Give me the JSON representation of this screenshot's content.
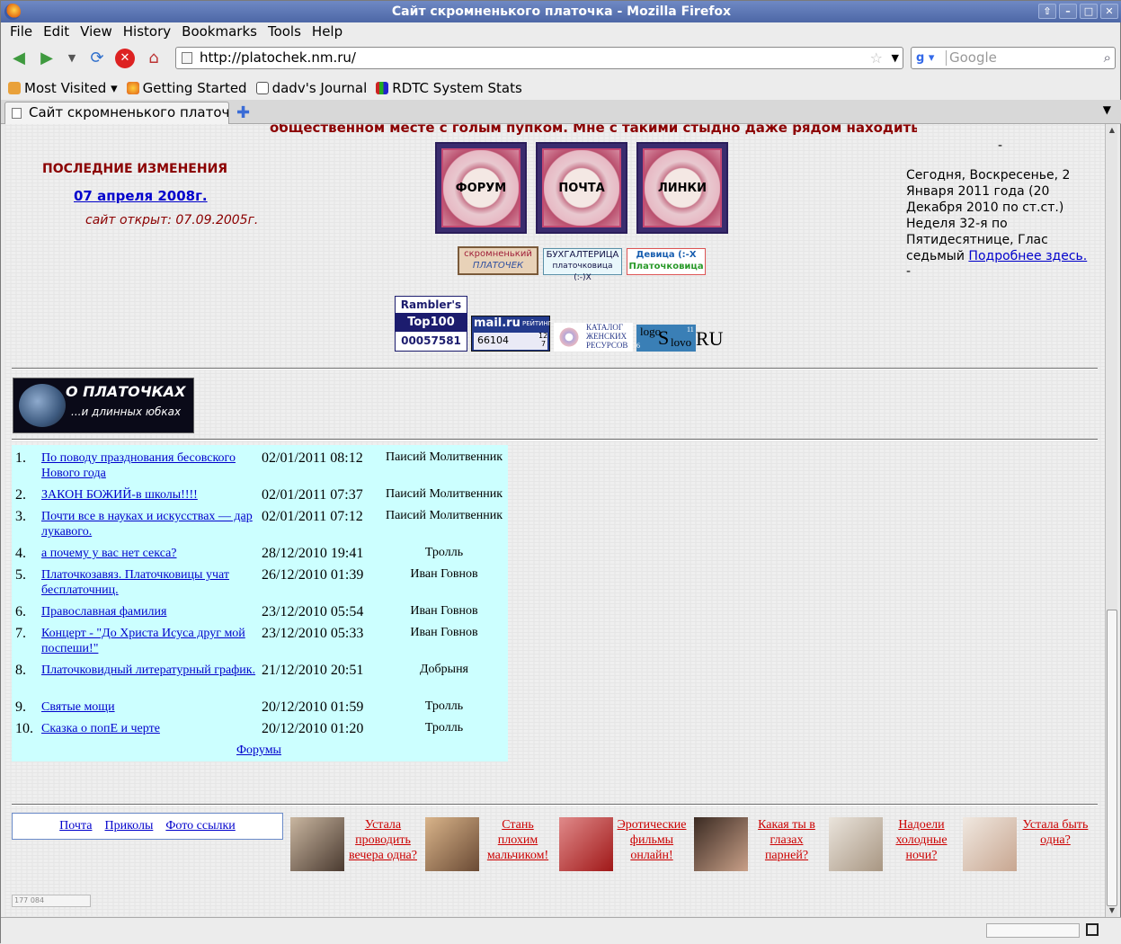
{
  "window": {
    "title": "Сайт скромненького платочка - Mozilla Firefox"
  },
  "menu": [
    "File",
    "Edit",
    "View",
    "History",
    "Bookmarks",
    "Tools",
    "Help"
  ],
  "toolbar": {
    "url": "http://platochek.nm.ru/",
    "search_placeholder": "Google"
  },
  "bookmarks": [
    "Most Visited",
    "Getting Started",
    "dadv's Journal",
    "RDTC System Stats"
  ],
  "tab": {
    "title": "Сайт скромненького платоч..."
  },
  "page": {
    "top_note": "общественном месте с голым пупком. Мне с такими стыдно даже рядом находиться.",
    "changes_heading": "ПОСЛЕДНИЕ ИЗМЕНЕНИЯ",
    "changes_date": "07 апреля 2008г.",
    "opened": "сайт открыт: 07.09.2005г.",
    "tiles": [
      "ФОРУМ",
      "ПОЧТА",
      "ЛИНКИ"
    ],
    "small_banners": {
      "b1_line1": "скромненький",
      "b1_line2": "ПЛАТОЧЕК",
      "b2_line1": "БУХГАЛТЕРИЦА",
      "b2_line2": "платочковица (:-)Х",
      "b3_line1": "Девица (:-Х",
      "b3_line2": "Платочковица"
    },
    "counters": {
      "rambler_1": "Rambler's",
      "rambler_2": "Top100",
      "rambler_3": "00057581",
      "mail_1": "mail.ru",
      "mail_2": "РЕЙТИНГ",
      "mail_3": "66104",
      "mail_4": "12",
      "mail_5": "7",
      "catalog_1": "КАТАЛОГ",
      "catalog_2": "ЖЕНСКИХ",
      "catalog_3": "РЕСУРСОВ",
      "logo_1": "logo",
      "logo_2": "S",
      "logo_3": "lovo",
      "logo_4": "RU",
      "logo_5": "11",
      "logo_6": "6"
    },
    "sidebar_dash_top": "-",
    "calendar": "Сегодня, Воскресенье, 2 Января 2011 года (20 Декабря 2010 по ст.ст.) Неделя 32-я по Пятидесятнице, Глас седьмый",
    "calendar_link": "Подробнее здесь.",
    "sidebar_dash_bottom": "-",
    "about_banner_1": "О ПЛАТОЧКАХ",
    "about_banner_2": "...и длинных юбках",
    "forum_posts": [
      {
        "n": "1.",
        "title": "По поводу празднования бесовского Нового года",
        "date": "02/01/2011 08:12",
        "author": "Паисий Молитвенник"
      },
      {
        "n": "2.",
        "title": "ЗАКОН БОЖИЙ-в школы!!!!",
        "date": "02/01/2011 07:37",
        "author": "Паисий Молитвенник"
      },
      {
        "n": "3.",
        "title": "Почти все в науках и искусствах — дар лукавого.",
        "date": "02/01/2011 07:12",
        "author": "Паисий Молитвенник"
      },
      {
        "n": "4.",
        "title": "а почему у вас нет секса?",
        "date": "28/12/2010 19:41",
        "author": "Тролль"
      },
      {
        "n": "5.",
        "title": "Платочкозавяз. Платочковицы учат бесплаточниц.",
        "date": "26/12/2010 01:39",
        "author": "Иван Говнов"
      },
      {
        "n": "6.",
        "title": "Православная фамилия",
        "date": "23/12/2010 05:54",
        "author": "Иван Говнов"
      },
      {
        "n": "7.",
        "title": "Концерт - \"До Христа Исуса друг мой поспеши!\"",
        "date": "23/12/2010 05:33",
        "author": "Иван Говнов"
      },
      {
        "n": "8.",
        "title": "Платочковидный литературный график.",
        "date": "21/12/2010 20:51",
        "author": "Добрыня"
      },
      {
        "n": "9.",
        "title": "Святые мощи",
        "date": "20/12/2010 01:59",
        "author": "Тролль"
      },
      {
        "n": "10.",
        "title": "Сказка о попЕ и черте",
        "date": "20/12/2010 01:20",
        "author": "Тролль"
      }
    ],
    "forums_link": "Форумы",
    "footer_links": [
      "Почта",
      "Приколы",
      "Фото ссылки"
    ],
    "ads": [
      "Устала проводить вечера одна?",
      "Стань плохим мальчиком!",
      "Эротические фильмы онлайн!",
      "Какая ты в глазах парней?",
      "Надоели холодные ночи?",
      "Устала быть одна?"
    ],
    "counter_small": "177 084"
  },
  "colors": {
    "note_red": "#8b0000",
    "link_blue": "#0000cc",
    "ad_red": "#cc0000",
    "table_bg": "#ccffff"
  }
}
